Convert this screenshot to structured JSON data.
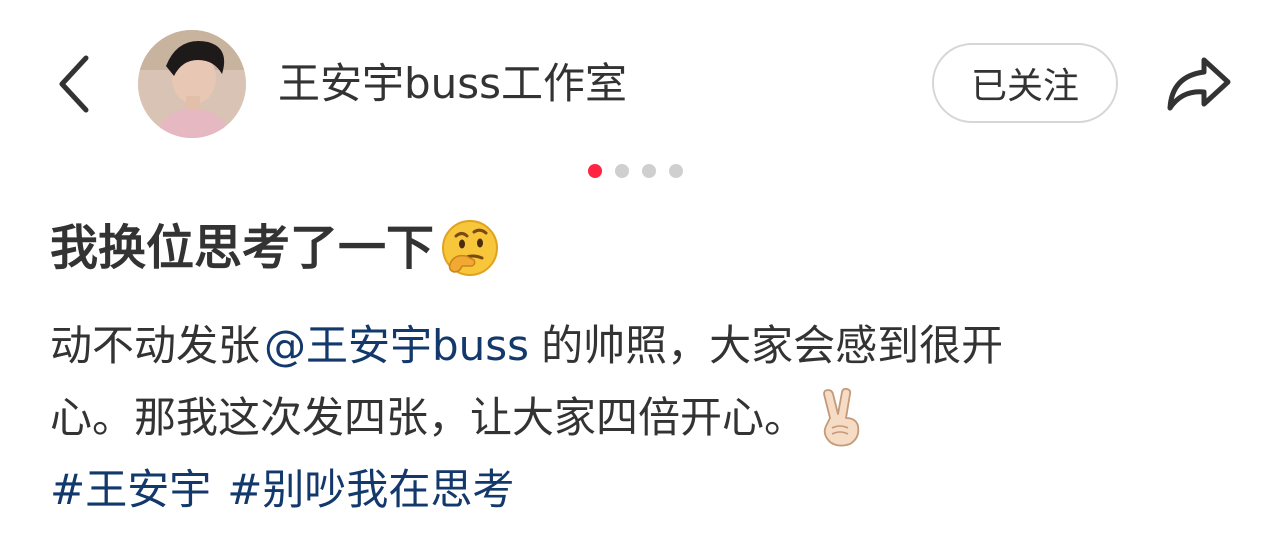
{
  "header": {
    "account_name": "王安宇buss工作室",
    "follow_label": "已关注"
  },
  "icons": {
    "back": "chevron-left-icon",
    "share": "share-arrow-icon",
    "thinking": "thinking-face-emoji",
    "victory": "victory-hand-emoji"
  },
  "carousel": {
    "total": 4,
    "active_index": 0
  },
  "post": {
    "title": "我换位思考了一下",
    "body_part1": "动不动发张",
    "mention": "@王安宇buss",
    "body_part2": "的帅照，大家会感到很开",
    "body_line2": "心。那我这次发四张，让大家四倍开心。",
    "hashtags": [
      "#王安宇",
      "#别吵我在思考"
    ]
  },
  "colors": {
    "accent": "#ff2442",
    "link": "#13386c",
    "text": "#333333"
  }
}
